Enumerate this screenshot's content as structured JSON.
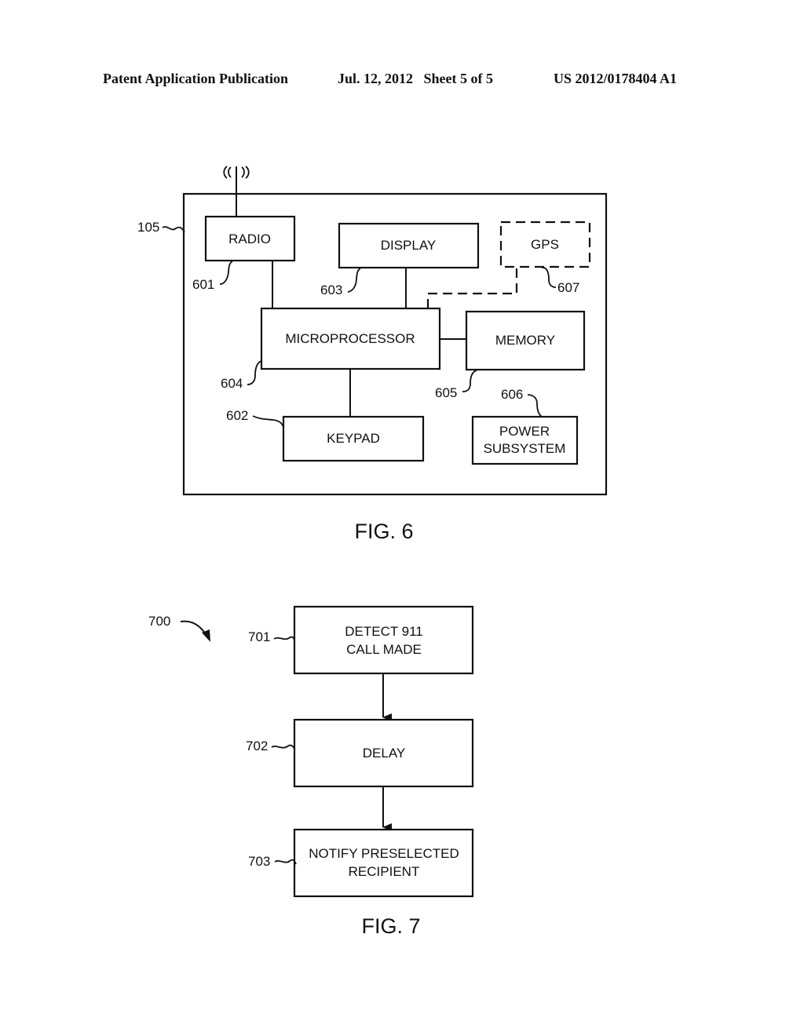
{
  "header": {
    "publication": "Patent Application Publication",
    "date_sheet": "Jul. 12, 2012   Sheet 5 of 5",
    "number": "US 2012/0178404 A1"
  },
  "fig6": {
    "caption": "FIG. 6",
    "device_ref": "105",
    "blocks": {
      "radio": {
        "label": "RADIO",
        "ref": "601"
      },
      "keypad": {
        "label": "KEYPAD",
        "ref": "602"
      },
      "display": {
        "label": "DISPLAY",
        "ref": "603"
      },
      "microprocessor": {
        "label": "MICROPROCESSOR",
        "ref": "604"
      },
      "memory": {
        "label": "MEMORY",
        "ref": "605"
      },
      "power": {
        "line1": "POWER",
        "line2": "SUBSYSTEM",
        "ref": "606"
      },
      "gps": {
        "label": "GPS",
        "ref": "607",
        "optional": true
      }
    }
  },
  "fig7": {
    "caption": "FIG. 7",
    "method_ref": "700",
    "steps": [
      {
        "ref": "701",
        "line1": "DETECT 911",
        "line2": "CALL MADE"
      },
      {
        "ref": "702",
        "line1": "DELAY",
        "line2": ""
      },
      {
        "ref": "703",
        "line1": "NOTIFY PRESELECTED",
        "line2": "RECIPIENT"
      }
    ]
  }
}
